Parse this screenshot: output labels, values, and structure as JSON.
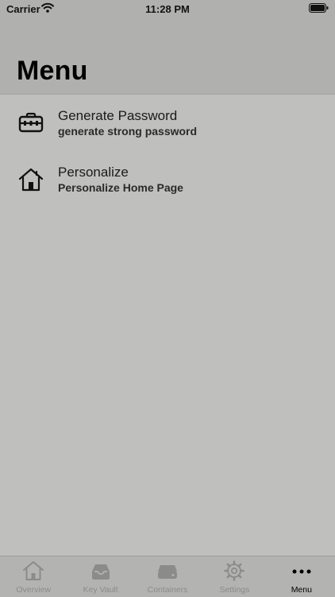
{
  "status_bar": {
    "carrier": "Carrier",
    "time": "11:28 PM",
    "wifi_icon": "wifi-icon",
    "battery_icon": "battery-icon"
  },
  "header": {
    "title": "Menu"
  },
  "menu": {
    "items": [
      {
        "title": "Generate Password",
        "subtitle": "generate strong password",
        "icon": "toolbox-icon"
      },
      {
        "title": "Personalize",
        "subtitle": "Personalize Home Page",
        "icon": "house-icon"
      }
    ]
  },
  "tab_bar": {
    "active": "Menu",
    "active_color": "#000000",
    "inactive_color": "#8b8c89",
    "tabs": [
      {
        "label": "Overview",
        "icon": "house-icon"
      },
      {
        "label": "Key Vault",
        "icon": "tray-icon"
      },
      {
        "label": "Containers",
        "icon": "drive-icon"
      },
      {
        "label": "Settings",
        "icon": "gear-icon"
      },
      {
        "label": "Menu",
        "icon": "more-dots-icon"
      }
    ]
  }
}
